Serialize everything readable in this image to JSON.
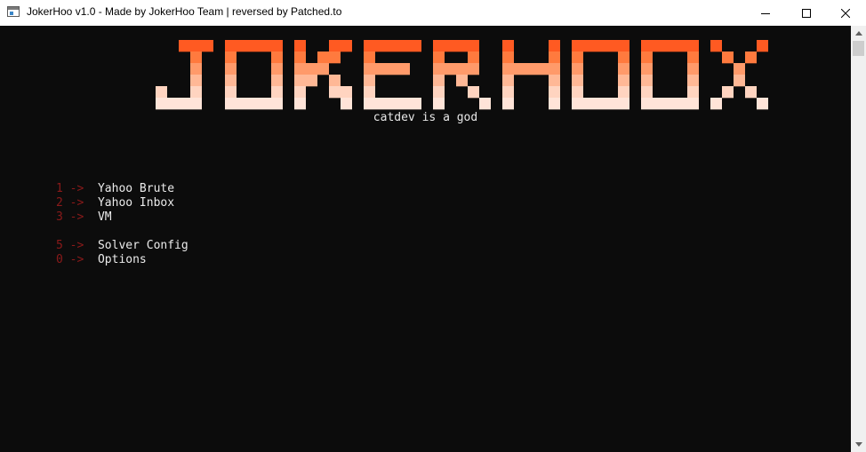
{
  "window": {
    "title": "JokerHoo v1.0 - Made by JokerHoo Team | reversed by Patched.to"
  },
  "banner": {
    "logo_text": "JOKERHOOX",
    "tagline": "catdev is a god",
    "gradient": [
      "#ff5a22",
      "#ff7a3e",
      "#ff9a6a",
      "#ffb896",
      "#ffd4c0",
      "#ffe4d8"
    ]
  },
  "menu": {
    "groups": [
      [
        {
          "key": "1",
          "arrow": "->",
          "label": "Yahoo Brute"
        },
        {
          "key": "2",
          "arrow": "->",
          "label": "Yahoo Inbox"
        },
        {
          "key": "3",
          "arrow": "->",
          "label": "VM"
        }
      ],
      [
        {
          "key": "5",
          "arrow": "->",
          "label": "Solver Config"
        },
        {
          "key": "0",
          "arrow": "->",
          "label": "Options"
        }
      ]
    ]
  },
  "colors": {
    "background": "#0c0c0c",
    "key": "#8b1a1a",
    "text": "#ebebeb"
  }
}
